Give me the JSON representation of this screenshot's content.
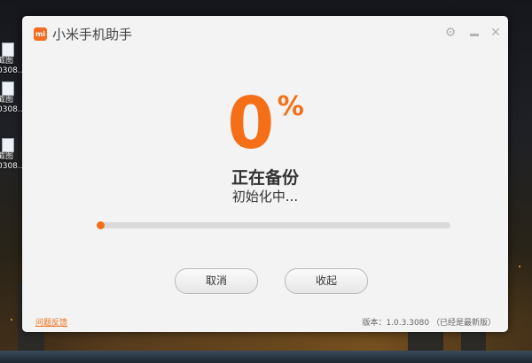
{
  "desktop": {
    "icons": [
      {
        "label_line1": "截图",
        "label_line2": "0308..."
      },
      {
        "label_line1": "截图",
        "label_line2": "0308..."
      },
      {
        "label_line1": "截图",
        "label_line2": "0308..."
      }
    ]
  },
  "window": {
    "title": "小米手机助手",
    "logo_text": "mi",
    "icons": {
      "settings": "⚙",
      "close": "✕"
    }
  },
  "backup": {
    "percent_value": "0",
    "percent_sign": "%",
    "status_main": "正在备份",
    "status_sub": "初始化中...",
    "progress_fraction": 0.0
  },
  "buttons": {
    "cancel": "取消",
    "collapse": "收起"
  },
  "footer": {
    "feedback_link": "问题反馈",
    "version": "版本：1.0.3.3080 （已经是最新版）"
  },
  "colors": {
    "accent": "#f46f17",
    "window_bg": "#f3f3f3"
  }
}
